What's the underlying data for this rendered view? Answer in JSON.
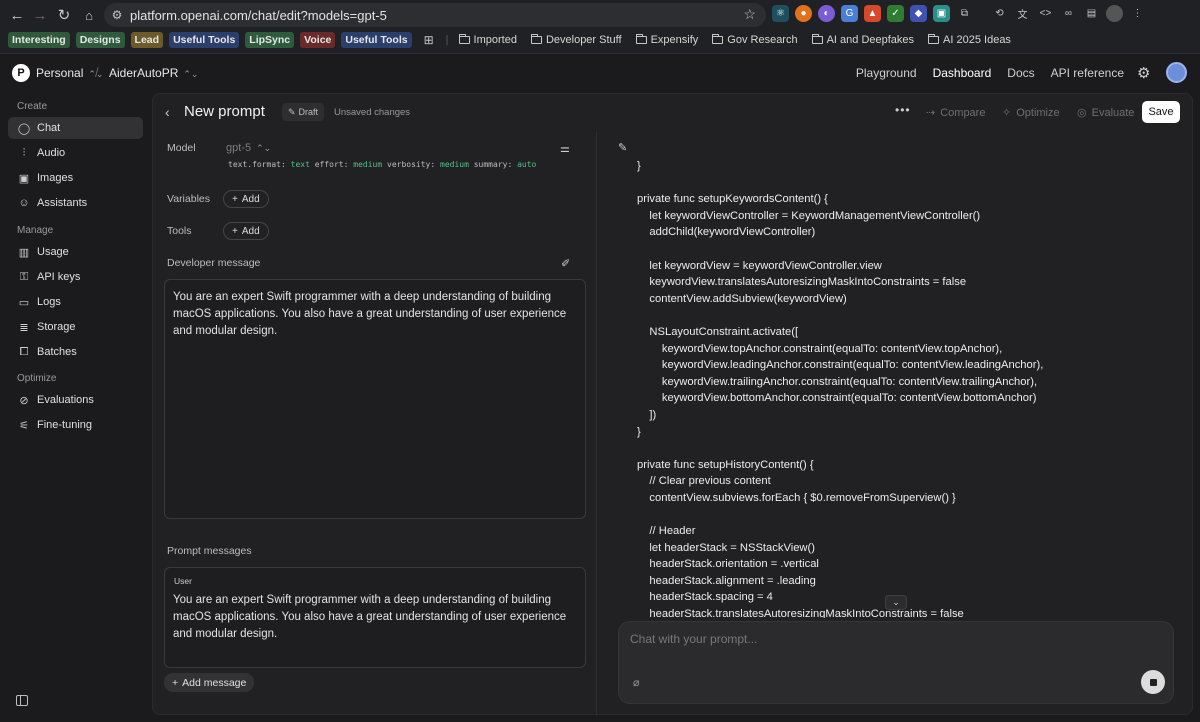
{
  "browser": {
    "url": "platform.openai.com/chat/edit?models=gpt-5",
    "bookmarks_tags": [
      {
        "label": "Interesting",
        "color": "#2f5a3a"
      },
      {
        "label": "Designs",
        "color": "#2e5a3e"
      },
      {
        "label": "Lead",
        "color": "#6b5a2a"
      },
      {
        "label": "Useful Tools",
        "color": "#2a3f6b"
      },
      {
        "label": "LipSync",
        "color": "#2e5a3e"
      },
      {
        "label": "Voice",
        "color": "#6b2a2a"
      },
      {
        "label": "Useful Tools",
        "color": "#2a3f6b"
      }
    ],
    "bookmark_folders": [
      "Imported",
      "Developer Stuff",
      "Expensify",
      "Gov Research",
      "AI and Deepfakes",
      "AI 2025 Ideas"
    ]
  },
  "header": {
    "org_initial": "P",
    "org_name": "Personal",
    "project_name": "AiderAutoPR",
    "nav": [
      "Playground",
      "Dashboard",
      "Docs",
      "API reference"
    ],
    "active_nav": "Dashboard"
  },
  "sidebar": {
    "sections": [
      {
        "label": "Create",
        "items": [
          {
            "label": "Chat",
            "icon": "chat-bubble-icon",
            "active": true
          },
          {
            "label": "Audio",
            "icon": "audio-wave-icon"
          },
          {
            "label": "Images",
            "icon": "image-icon"
          },
          {
            "label": "Assistants",
            "icon": "robot-icon"
          }
        ]
      },
      {
        "label": "Manage",
        "items": [
          {
            "label": "Usage",
            "icon": "bar-chart-icon"
          },
          {
            "label": "API keys",
            "icon": "key-icon"
          },
          {
            "label": "Logs",
            "icon": "logs-icon"
          },
          {
            "label": "Storage",
            "icon": "database-icon"
          },
          {
            "label": "Batches",
            "icon": "batches-icon"
          }
        ]
      },
      {
        "label": "Optimize",
        "items": [
          {
            "label": "Evaluations",
            "icon": "compass-icon"
          },
          {
            "label": "Fine-tuning",
            "icon": "tuning-icon"
          }
        ]
      }
    ]
  },
  "prompt": {
    "title": "New prompt",
    "badge": "Draft",
    "status": "Unsaved changes",
    "actions": {
      "compare": "Compare",
      "optimize": "Optimize",
      "evaluate": "Evaluate",
      "save": "Save"
    }
  },
  "config": {
    "model_label": "Model",
    "model_value": "gpt-5",
    "params": [
      {
        "key": "text.format:",
        "value": "text"
      },
      {
        "key": "effort:",
        "value": "medium"
      },
      {
        "key": "verbosity:",
        "value": "medium"
      },
      {
        "key": "summary:",
        "value": "auto"
      }
    ],
    "variables_label": "Variables",
    "tools_label": "Tools",
    "add_label": "Add",
    "developer_message_label": "Developer message",
    "developer_message": "You are an expert Swift programmer with a deep understanding of building macOS applications. You also have a great understanding of user experience and modular design.",
    "prompt_messages_label": "Prompt messages",
    "user_role": "User",
    "user_message": "You are an expert Swift programmer with a deep understanding of building macOS applications. You also have a great understanding of user experience and modular design.",
    "add_message_label": "Add message"
  },
  "output": {
    "code_lines": [
      "}",
      "",
      "private func setupKeywordsContent() {",
      "    let keywordViewController = KeywordManagementViewController()",
      "    addChild(keywordViewController)",
      "",
      "    let keywordView = keywordViewController.view",
      "    keywordView.translatesAutoresizingMaskIntoConstraints = false",
      "    contentView.addSubview(keywordView)",
      "",
      "    NSLayoutConstraint.activate([",
      "        keywordView.topAnchor.constraint(equalTo: contentView.topAnchor),",
      "        keywordView.leadingAnchor.constraint(equalTo: contentView.leadingAnchor),",
      "        keywordView.trailingAnchor.constraint(equalTo: contentView.trailingAnchor),",
      "        keywordView.bottomAnchor.constraint(equalTo: contentView.bottomAnchor)",
      "    ])",
      "}",
      "",
      "private func setupHistoryContent() {",
      "    // Clear previous content",
      "    contentView.subviews.forEach { $0.removeFromSuperview() }",
      "",
      "    // Header",
      "    let headerStack = NSStackView()",
      "    headerStack.orientation = .vertical",
      "    headerStack.alignment = .leading",
      "    headerStack.spacing = 4",
      "    headerStack.translatesAutoresizingMaskIntoConstraints = false"
    ],
    "chat_placeholder": "Chat with your prompt..."
  }
}
